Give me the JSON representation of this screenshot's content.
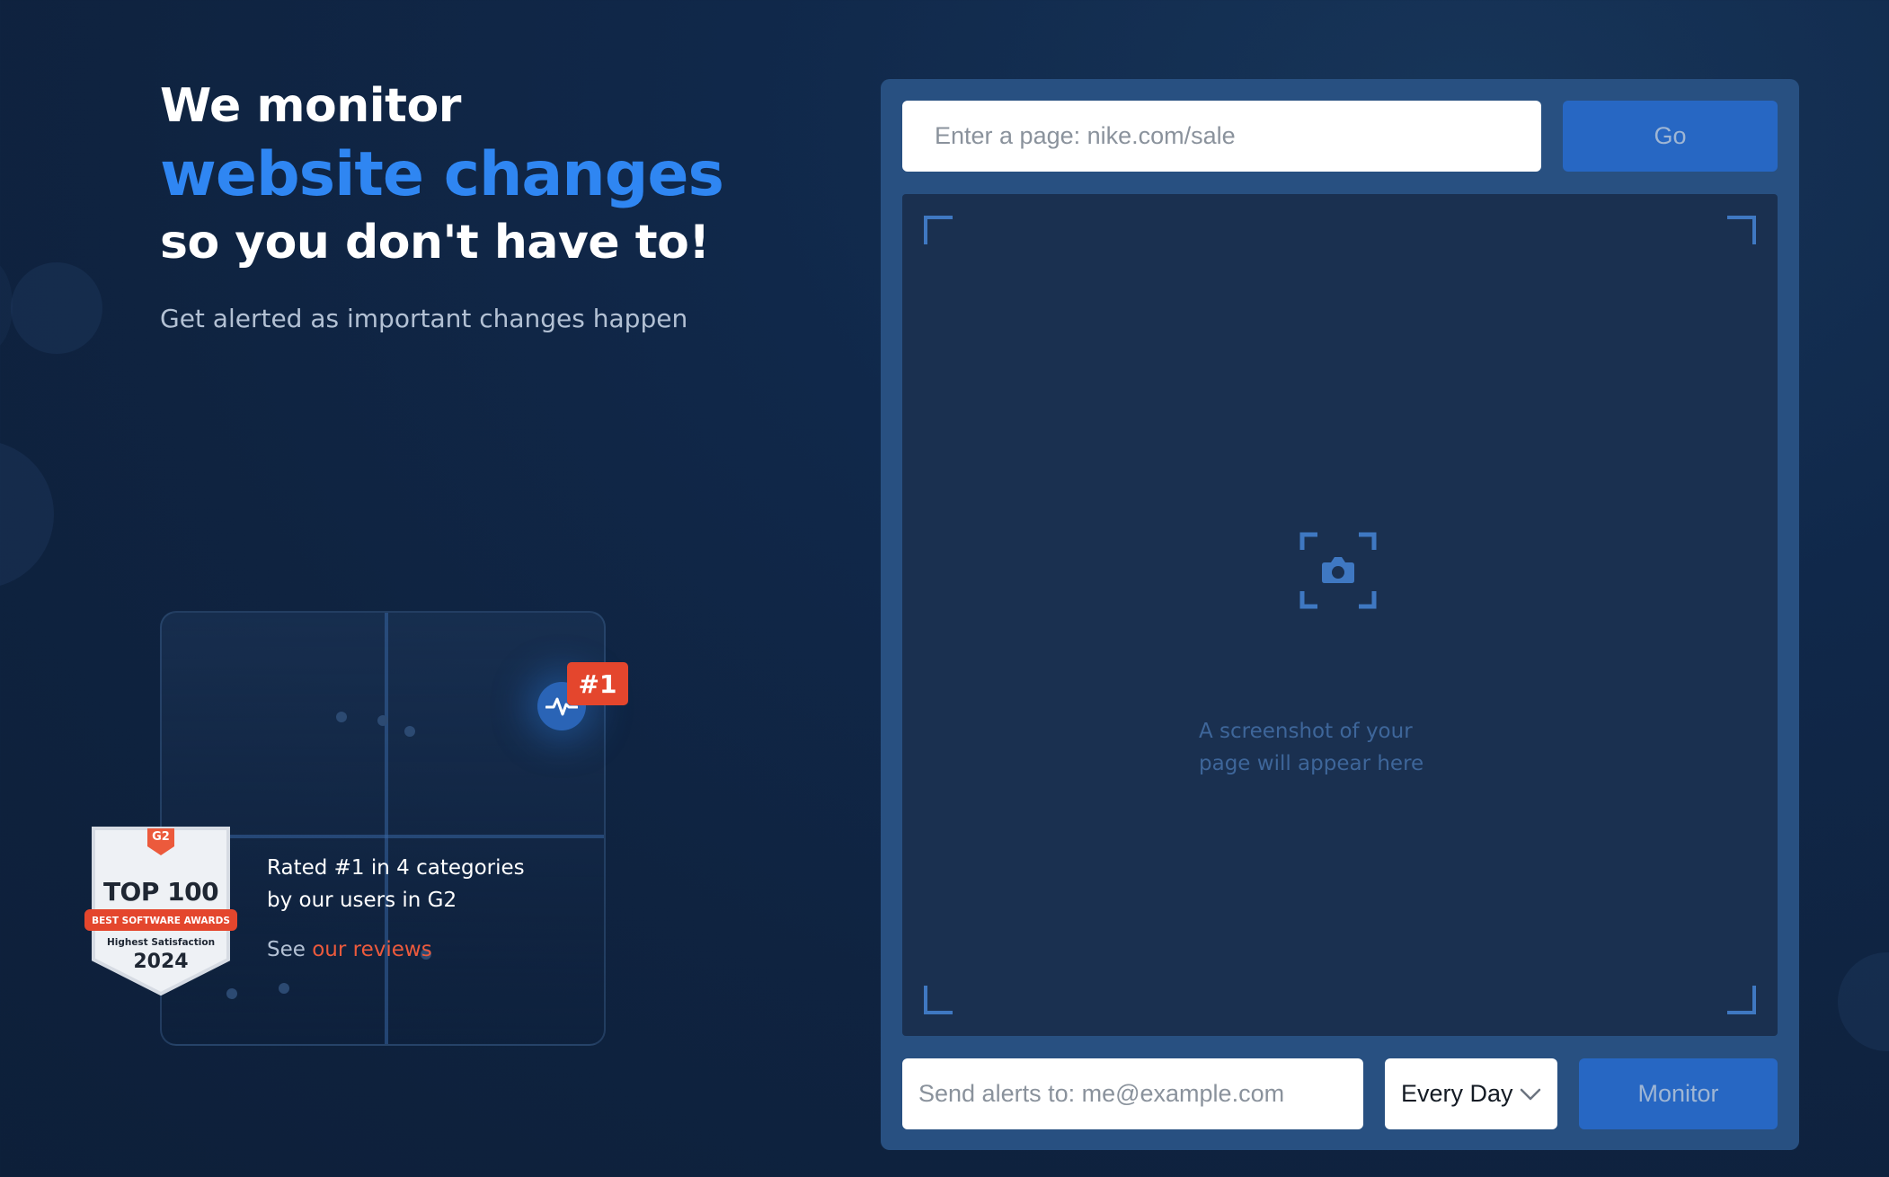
{
  "hero": {
    "line1": "We monitor",
    "line2": "website changes",
    "line3": "so you don't have to!",
    "subtitle": "Get alerted as important changes happen"
  },
  "g2": {
    "rank_badge": "#1",
    "badge_logo": "G2",
    "badge_title": "TOP 100",
    "badge_ribbon": "BEST SOFTWARE AWARDS",
    "badge_subtitle": "Highest Satisfaction",
    "badge_year": "2024",
    "rated_line1": "Rated #1 in 4 categories",
    "rated_line2": "by our users in G2",
    "see_prefix": "See ",
    "reviews_link": "our reviews"
  },
  "monitor": {
    "url_placeholder": "Enter a page: nike.com/sale",
    "url_value": "",
    "go_label": "Go",
    "screenshot_placeholder_line1": "A screenshot of your",
    "screenshot_placeholder_line2": "page will appear here",
    "email_placeholder": "Send alerts to: me@example.com",
    "email_value": "",
    "frequency_selected": "Every Day",
    "monitor_label": "Monitor"
  },
  "colors": {
    "background": "#0f2340",
    "accent_blue": "#2f86f2",
    "button_blue": "#2767c3",
    "panel_blue": "#285081",
    "badge_red": "#e4462d",
    "link_orange": "#ec5a3c"
  },
  "icons": {
    "pulse": "pulse-icon",
    "camera": "camera-icon",
    "chevron": "chevron-down-icon"
  }
}
